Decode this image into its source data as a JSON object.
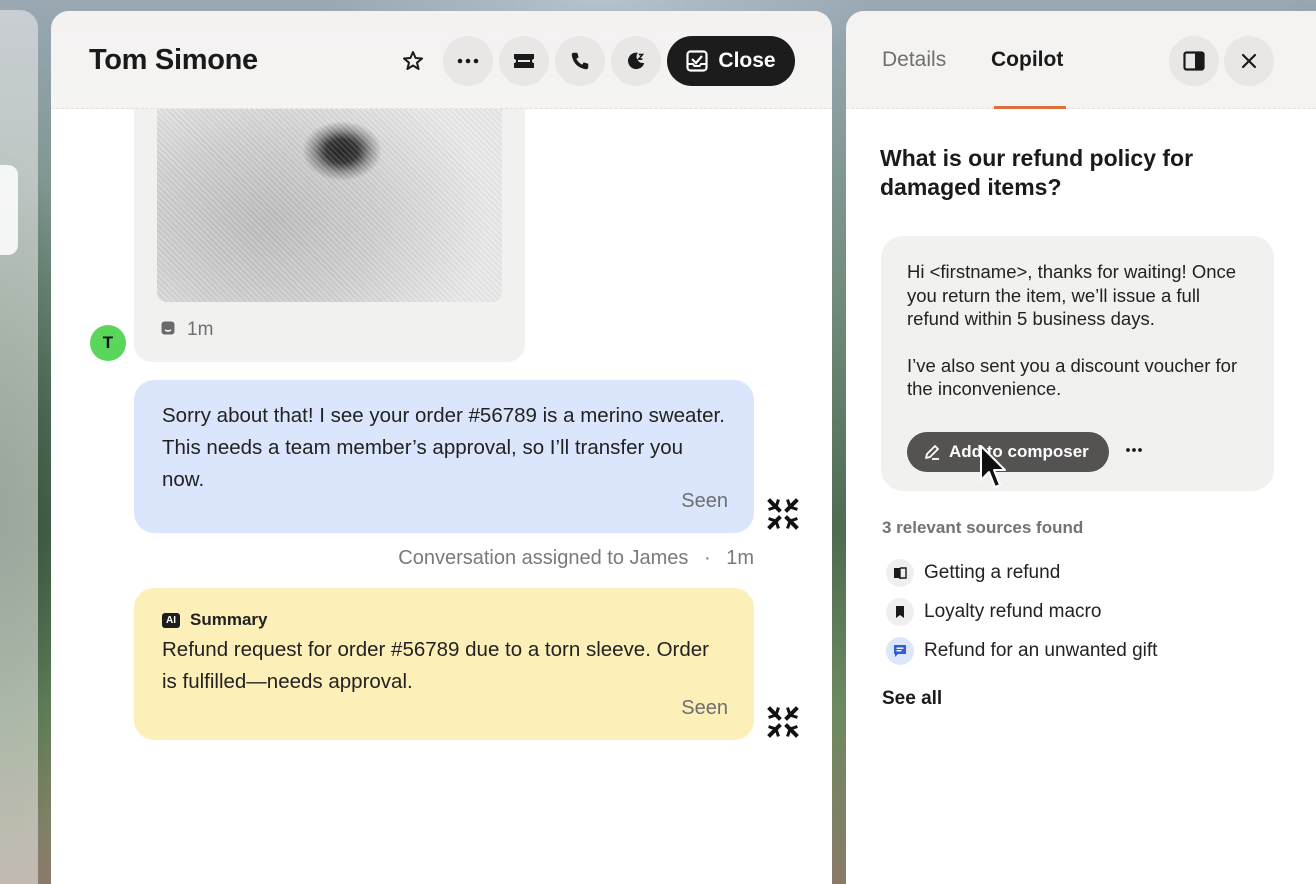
{
  "conversation": {
    "title": "Tom Simone",
    "close_label": "Close",
    "image_message": {
      "time": "1m",
      "avatar_letter": "T"
    },
    "agent_message": {
      "text": "Sorry about that! I see your order #56789 is a merino sweater. This needs a team member’s approval, so I’ll transfer you now.",
      "status": "Seen"
    },
    "assignment": {
      "text": "Conversation assigned to James",
      "separator": "·",
      "time": "1m"
    },
    "summary": {
      "badge": "AI",
      "title": "Summary",
      "text": "Refund request for order #56789 due to a torn sleeve. Order is fulfilled—needs approval.",
      "status": "Seen"
    },
    "icons": [
      "star-icon",
      "more-icon",
      "ticket-icon",
      "phone-icon",
      "snooze-icon",
      "inbox-check-icon"
    ]
  },
  "copilot": {
    "tabs": [
      {
        "label": "Details",
        "active": false
      },
      {
        "label": "Copilot",
        "active": true
      }
    ],
    "question": "What is our refund policy for damaged items?",
    "answer": {
      "paragraph1": "Hi <firstname>, thanks for waiting! Once you return the item, we’ll issue a full refund within 5 business days.",
      "paragraph2": "I’ve also sent you a discount voucher for the inconvenience.",
      "add_button": "Add to composer"
    },
    "sources_label": "3 relevant sources found",
    "sources": [
      {
        "label": "Getting a refund",
        "icon": "book-icon"
      },
      {
        "label": "Loyalty refund macro",
        "icon": "bookmark-icon"
      },
      {
        "label": "Refund for an unwanted gift",
        "icon": "chat-icon"
      }
    ],
    "see_all": "See all"
  },
  "colors": {
    "accent": "#e0703a",
    "agent_bubble": "#dbe6fd",
    "summary_bubble": "#fcefb8",
    "avatar": "#5ad65a"
  }
}
